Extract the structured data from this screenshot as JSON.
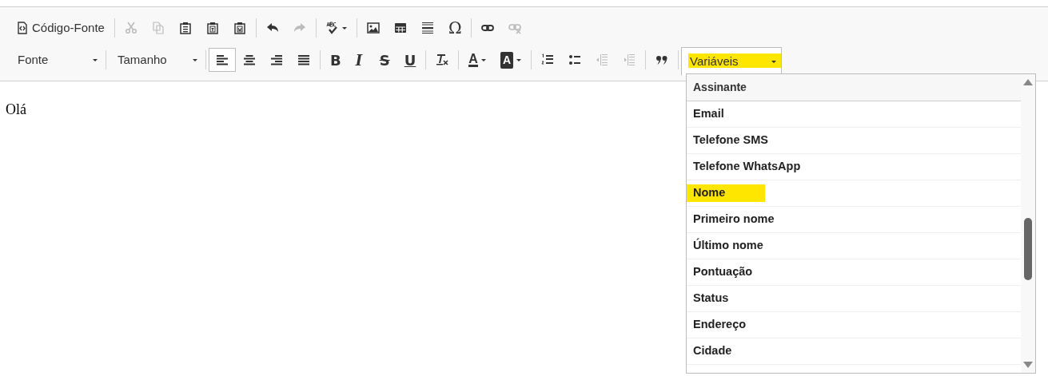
{
  "toolbar": {
    "rows": [
      [
        {
          "buttons": [
            {
              "kind": "text",
              "label": "Código-Fonte",
              "disabled": false
            }
          ]
        },
        {
          "buttons": [
            {
              "kind": "icon",
              "disabled": true
            },
            {
              "kind": "icon",
              "disabled": true
            },
            {
              "kind": "icon",
              "disabled": false
            },
            {
              "kind": "icon",
              "disabled": false
            },
            {
              "kind": "icon",
              "disabled": false
            }
          ]
        },
        {
          "buttons": [
            {
              "kind": "icon",
              "disabled": false
            },
            {
              "kind": "icon",
              "disabled": true
            }
          ]
        },
        {
          "buttons": [
            {
              "kind": "menu",
              "disabled": false
            }
          ]
        },
        {
          "buttons": [
            {
              "kind": "icon",
              "disabled": false
            },
            {
              "kind": "icon",
              "disabled": false
            },
            {
              "kind": "icon",
              "disabled": false
            },
            {
              "kind": "glyph",
              "label": "Ω",
              "disabled": false
            }
          ]
        },
        {
          "buttons": [
            {
              "kind": "icon",
              "disabled": false
            },
            {
              "kind": "icon",
              "disabled": true
            }
          ]
        }
      ],
      [
        {
          "buttons": [
            {
              "kind": "combo",
              "label": "Fonte",
              "open": false,
              "highlighted": false
            }
          ]
        },
        {
          "buttons": [
            {
              "kind": "combo",
              "label": "Tamanho",
              "open": false,
              "highlighted": false
            }
          ]
        },
        {
          "buttons": [
            {
              "kind": "icon",
              "disabled": false,
              "pressed": true
            },
            {
              "kind": "icon",
              "disabled": false,
              "pressed": false
            },
            {
              "kind": "icon",
              "disabled": false,
              "pressed": false
            },
            {
              "kind": "icon",
              "disabled": false,
              "pressed": false
            }
          ]
        },
        {
          "buttons": [
            {
              "kind": "glyph",
              "label": "B",
              "disabled": false
            },
            {
              "kind": "glyph",
              "label": "I",
              "disabled": false
            },
            {
              "kind": "glyph",
              "label": "S",
              "disabled": false
            },
            {
              "kind": "glyph",
              "label": "U",
              "disabled": false
            }
          ]
        },
        {
          "buttons": [
            {
              "kind": "icon",
              "disabled": false
            }
          ]
        },
        {
          "buttons": [
            {
              "kind": "color",
              "label": "A",
              "disabled": false
            },
            {
              "kind": "bgcolor",
              "label": "A",
              "disabled": false
            }
          ]
        },
        {
          "buttons": [
            {
              "kind": "icon",
              "disabled": false
            },
            {
              "kind": "icon",
              "disabled": false
            },
            {
              "kind": "icon",
              "disabled": true
            },
            {
              "kind": "icon",
              "disabled": true
            }
          ]
        },
        {
          "buttons": [
            {
              "kind": "icon",
              "disabled": false
            }
          ]
        },
        {
          "buttons": [
            {
              "kind": "combo",
              "label": "Variáveis",
              "open": true,
              "highlighted": true
            }
          ]
        }
      ]
    ]
  },
  "editor": {
    "text": "Olá"
  },
  "dropdown": {
    "header": "Assinante",
    "items": [
      {
        "label": "Email",
        "highlighted": false
      },
      {
        "label": "Telefone SMS",
        "highlighted": false
      },
      {
        "label": "Telefone WhatsApp",
        "highlighted": false
      },
      {
        "label": "Nome",
        "highlighted": true
      },
      {
        "label": "Primeiro nome",
        "highlighted": false
      },
      {
        "label": "Último nome",
        "highlighted": false
      },
      {
        "label": "Pontuação",
        "highlighted": false
      },
      {
        "label": "Status",
        "highlighted": false
      },
      {
        "label": "Endereço",
        "highlighted": false
      },
      {
        "label": "Cidade",
        "highlighted": false
      }
    ]
  }
}
